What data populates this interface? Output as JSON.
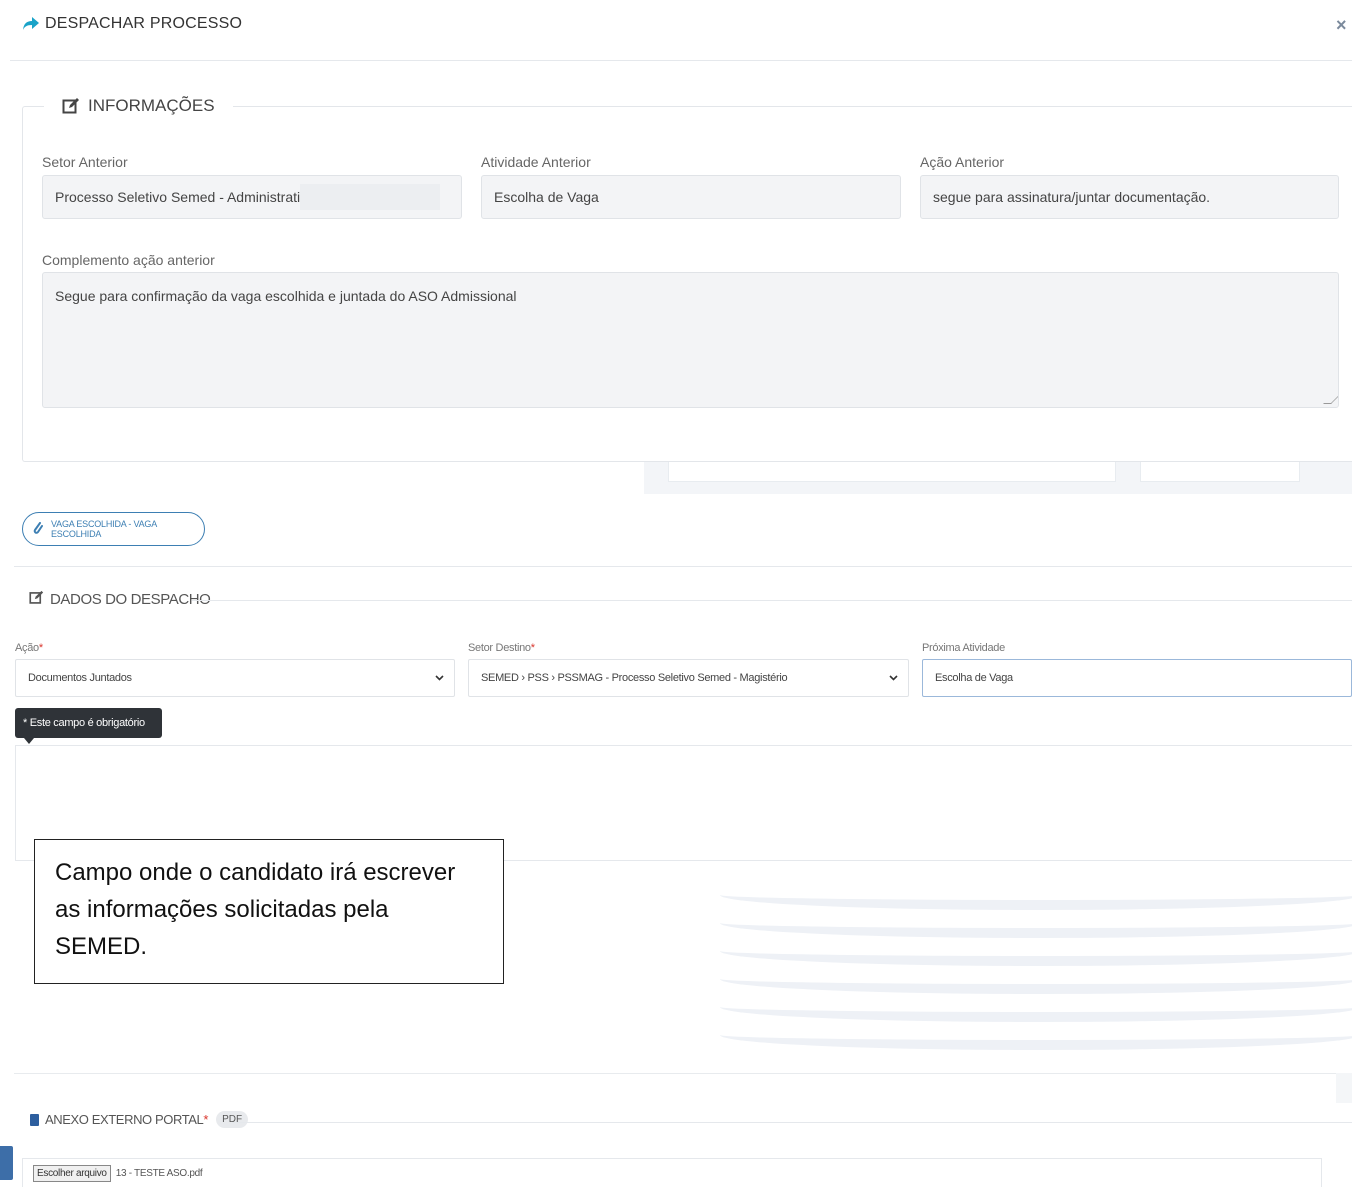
{
  "header": {
    "title": "DESPACHAR PROCESSO",
    "close_icon": "×"
  },
  "info": {
    "legend": "INFORMAÇÕES",
    "setor_label": "Setor Anterior",
    "setor_value": "Processo Seletivo Semed - Administrati",
    "atividade_label": "Atividade Anterior",
    "atividade_value": "Escolha de Vaga",
    "acao_label": "Ação Anterior",
    "acao_value": "segue para assinatura/juntar documentação.",
    "complemento_label": "Complemento ação anterior",
    "complemento_value": "Segue para confirmação da vaga escolhida e juntada do ASO Admissional"
  },
  "attachment_pill": {
    "label": "VAGA ESCOLHIDA - VAGA ESCOLHIDA"
  },
  "dispatch": {
    "legend": "DADOS DO DESPACHO",
    "acao_label": "Ação",
    "acao_value": "Documentos Juntados",
    "setor_label": "Setor Destino",
    "setor_value": "SEMED › PSS › PSSMAG - Processo Seletivo Semed - Magistério",
    "proxima_label": "Próxima Atividade",
    "proxima_value": "Escolha de Vaga",
    "required_mark": "*",
    "tooltip": "* Este campo é obrigatório"
  },
  "callout": {
    "text": "Campo onde o candidato irá escrever as informações solicitadas pela SEMED."
  },
  "anexo": {
    "legend": "ANEXO EXTERNO PORTAL",
    "required_mark": "*",
    "badge": "PDF",
    "file_button": "Escolher arquivo",
    "file_name": "13 - TESTE ASO.pdf"
  },
  "colors": {
    "accent": "#1aa3c8",
    "pill": "#3d7fb3",
    "required": "#d9342b",
    "tooltip_bg": "#2f3338"
  }
}
